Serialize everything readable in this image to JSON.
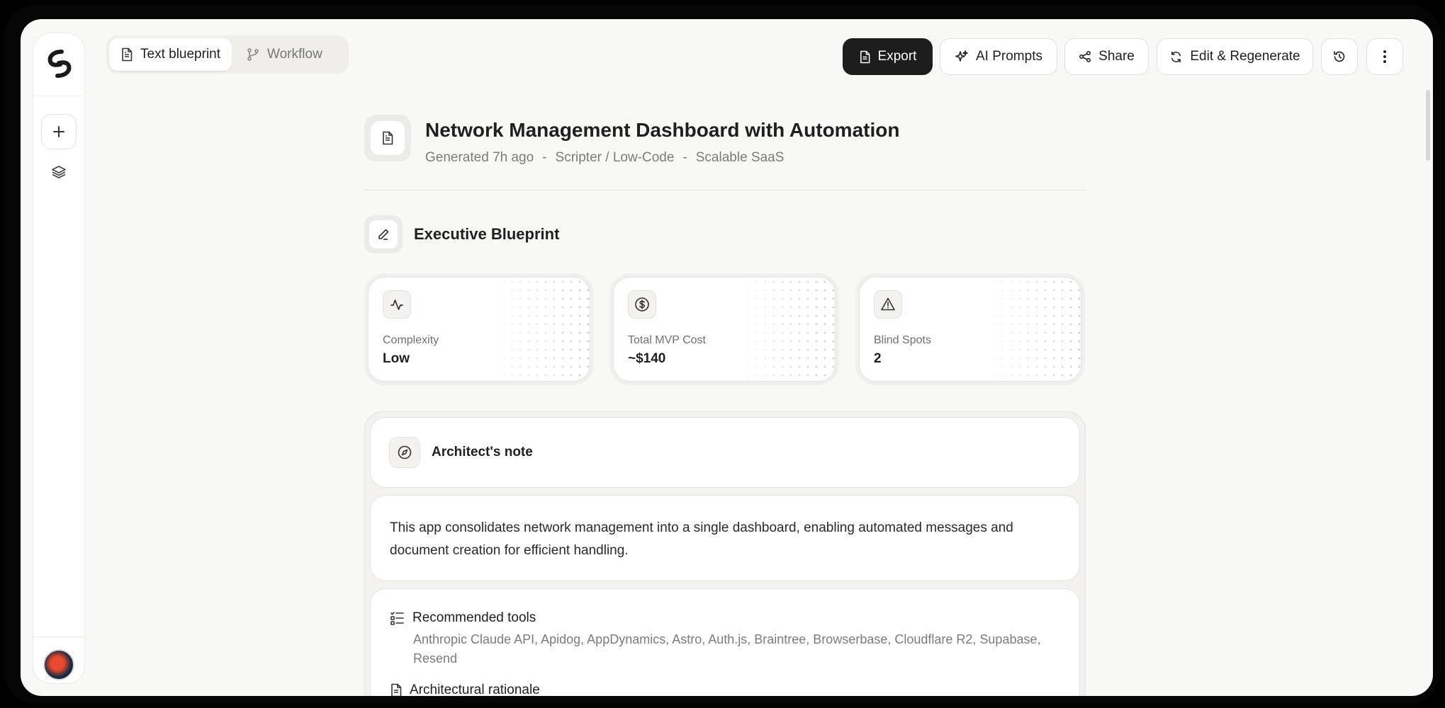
{
  "colors": {
    "accent_dark": "#1d1d1d",
    "background": "#f8f8f6",
    "muted_text": "#7b7b7b"
  },
  "sidebar": {
    "logo_icon": "brand-logo-icon",
    "new_icon": "plus-icon",
    "layers_icon": "layers-icon",
    "avatar_icon": "user-avatar"
  },
  "view_tabs": [
    {
      "label": "Text blueprint",
      "icon": "document-icon",
      "active": true
    },
    {
      "label": "Workflow",
      "icon": "git-branch-icon",
      "active": false
    }
  ],
  "toolbar": {
    "export_label": "Export",
    "ai_prompts_label": "AI Prompts",
    "share_label": "Share",
    "edit_regenerate_label": "Edit & Regenerate",
    "history_icon": "history-icon",
    "more_icon": "more-vertical-icon"
  },
  "doc": {
    "title": "Network Management Dashboard with Automation",
    "meta_generated": "Generated 7h ago",
    "meta_sep": "-",
    "meta_persona": "Scripter / Low-Code",
    "meta_scale": "Scalable SaaS"
  },
  "executive": {
    "title": "Executive Blueprint",
    "cards": [
      {
        "label": "Complexity",
        "value": "Low",
        "icon": "activity-icon"
      },
      {
        "label": "Total MVP Cost",
        "value": "~$140",
        "icon": "dollar-circle-icon"
      },
      {
        "label": "Blind Spots",
        "value": "2",
        "icon": "warning-triangle-icon"
      }
    ]
  },
  "architect_note": {
    "title": "Architect's note",
    "body": "This app consolidates network management into a single dashboard, enabling automated messages and document creation for efficient handling."
  },
  "recommended_tools": {
    "title": "Recommended tools",
    "body": "Anthropic Claude API, Apidog, AppDynamics, Astro, Auth.js, Braintree, Browserbase, Cloudflare R2, Supabase, Resend"
  },
  "architectural_rationale": {
    "title": "Architectural rationale"
  }
}
